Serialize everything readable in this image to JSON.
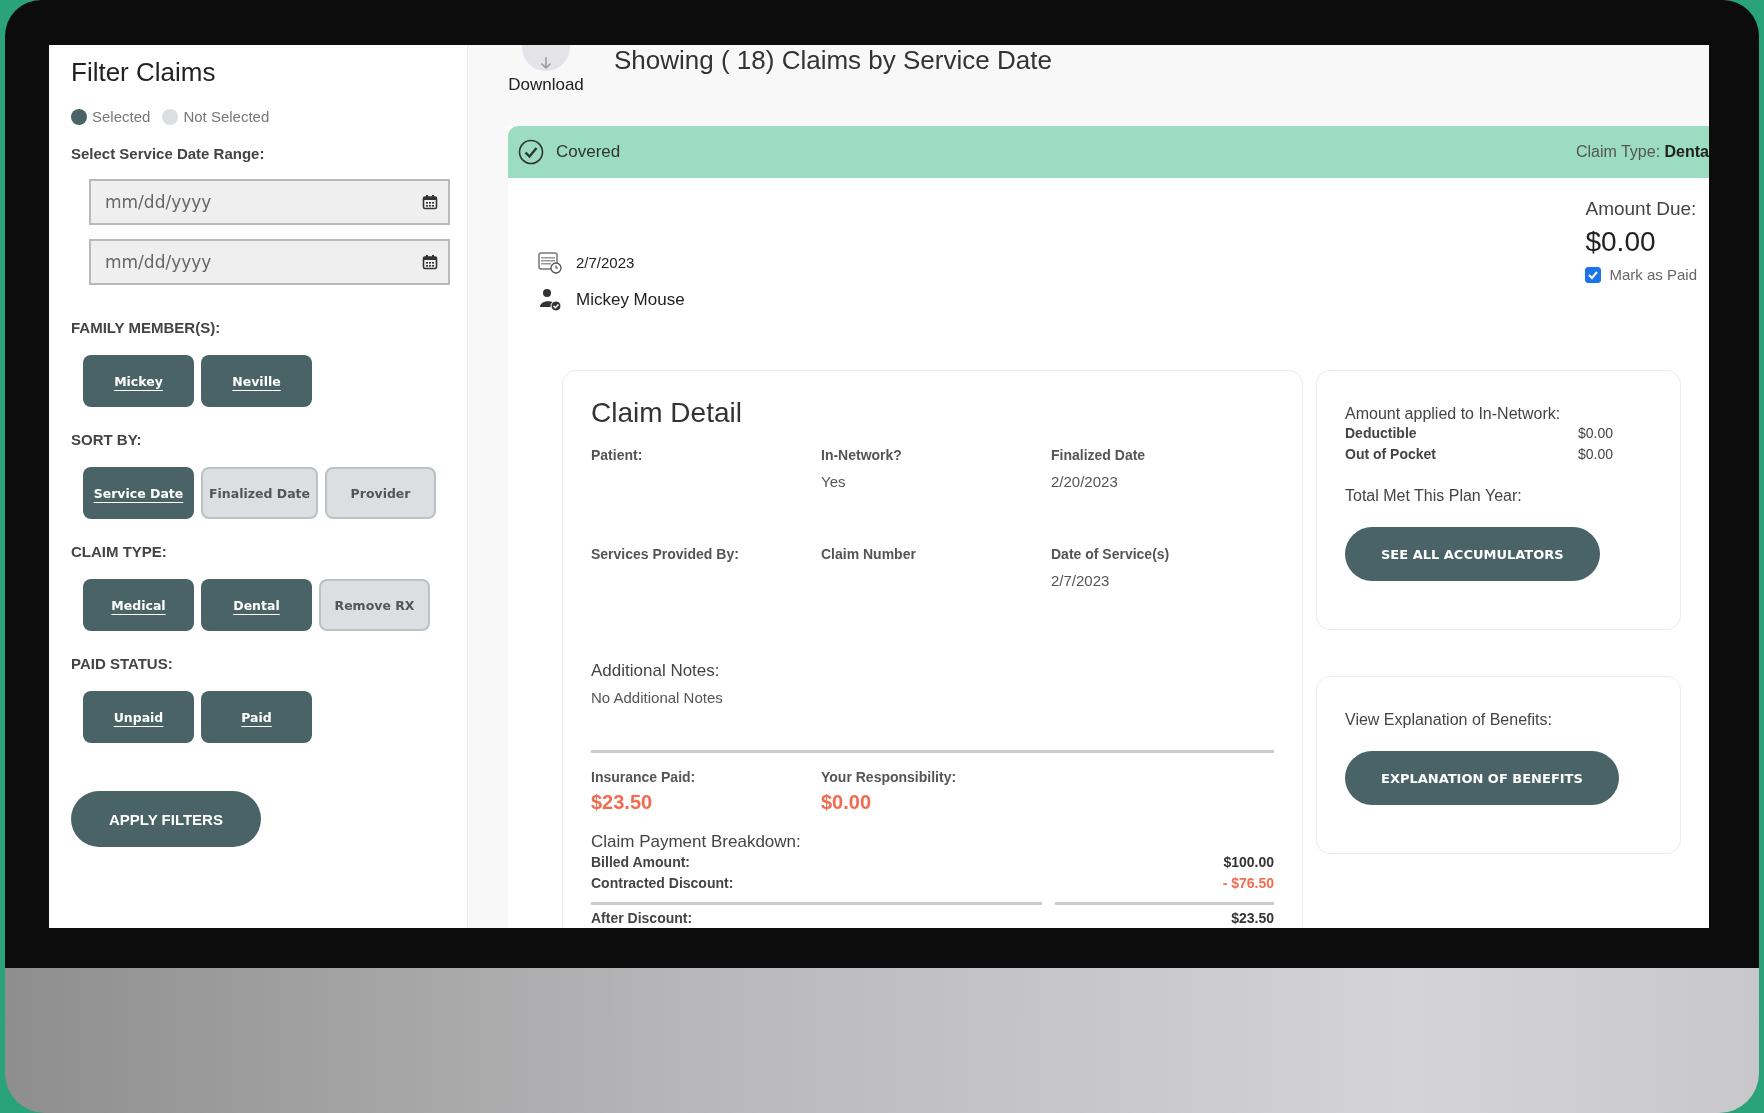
{
  "sidebar": {
    "title": "Filter Claims",
    "legend": [
      {
        "label": "Selected",
        "selected": true
      },
      {
        "label": "Not Selected",
        "selected": false
      }
    ],
    "date_range": {
      "label": "Select Service Date Range:",
      "fields": [
        {
          "placeholder": "mm/dd/yyyy"
        },
        {
          "placeholder": "mm/dd/yyyy"
        }
      ]
    },
    "groups": [
      {
        "label": "FAMILY MEMBER(S):",
        "options": [
          {
            "label": "Mickey",
            "selected": true
          },
          {
            "label": "Neville",
            "selected": true
          }
        ]
      },
      {
        "label": "SORT BY:",
        "options": [
          {
            "label": "Service Date",
            "selected": true
          },
          {
            "label": "Finalized Date",
            "selected": false
          },
          {
            "label": "Provider",
            "selected": false
          }
        ]
      },
      {
        "label": "CLAIM TYPE:",
        "options": [
          {
            "label": "Medical",
            "selected": true
          },
          {
            "label": "Dental",
            "selected": true
          },
          {
            "label": "Remove RX",
            "selected": false
          }
        ]
      },
      {
        "label": "PAID STATUS:",
        "options": [
          {
            "label": "Unpaid",
            "selected": true
          },
          {
            "label": "Paid",
            "selected": true
          }
        ]
      }
    ],
    "apply_button": "APPLY FILTERS"
  },
  "main": {
    "download": {
      "label": "Download"
    },
    "heading": "Showing ( 18) Claims by Service Date",
    "claim": {
      "status": "Covered",
      "claim_type_label": "Claim Type:",
      "claim_type_value": "Denta",
      "service_date": "2/7/2023",
      "member": "Mickey Mouse",
      "amount_due_label": "Amount Due:",
      "amount_due": "$0.00",
      "mark_as_paid": {
        "label": "Mark as Paid",
        "checked": true
      },
      "detail": {
        "title": "Claim Detail",
        "fields": [
          {
            "label": "Patient:"
          },
          {
            "label": "In-Network?",
            "value": "Yes"
          },
          {
            "label": "Finalized Date",
            "value": "2/20/2023"
          },
          {
            "label": "Services Provided By:"
          },
          {
            "label": "Claim Number"
          },
          {
            "label": "Date of Service(s)",
            "value": "2/7/2023"
          }
        ],
        "notes_label": "Additional Notes:",
        "notes": "No Additional Notes",
        "totals": [
          {
            "label": "Insurance Paid:",
            "value": "$23.50"
          },
          {
            "label": "Your Responsibility:",
            "value": "$0.00"
          }
        ],
        "breakdown_label": "Claim Payment Breakdown:",
        "breakdown": [
          {
            "label": "Billed Amount:",
            "value": "$100.00",
            "kind": "charge"
          },
          {
            "label": "Contracted Discount:",
            "value": "- $76.50",
            "kind": "discount"
          },
          {
            "label": "After Discount:",
            "value": "$23.50",
            "kind": "total"
          }
        ]
      },
      "accumulators": {
        "title": "Amount applied to In-Network:",
        "rows": [
          {
            "label": "Deductible",
            "value": "$0.00"
          },
          {
            "label": "Out of Pocket",
            "value": "$0.00"
          }
        ],
        "subtitle": "Total Met This Plan Year:",
        "button": "SEE ALL ACCUMULATORS"
      },
      "eob": {
        "title": "View Explanation of Benefits:",
        "button": "EXPLANATION OF BENEFITS"
      }
    }
  }
}
